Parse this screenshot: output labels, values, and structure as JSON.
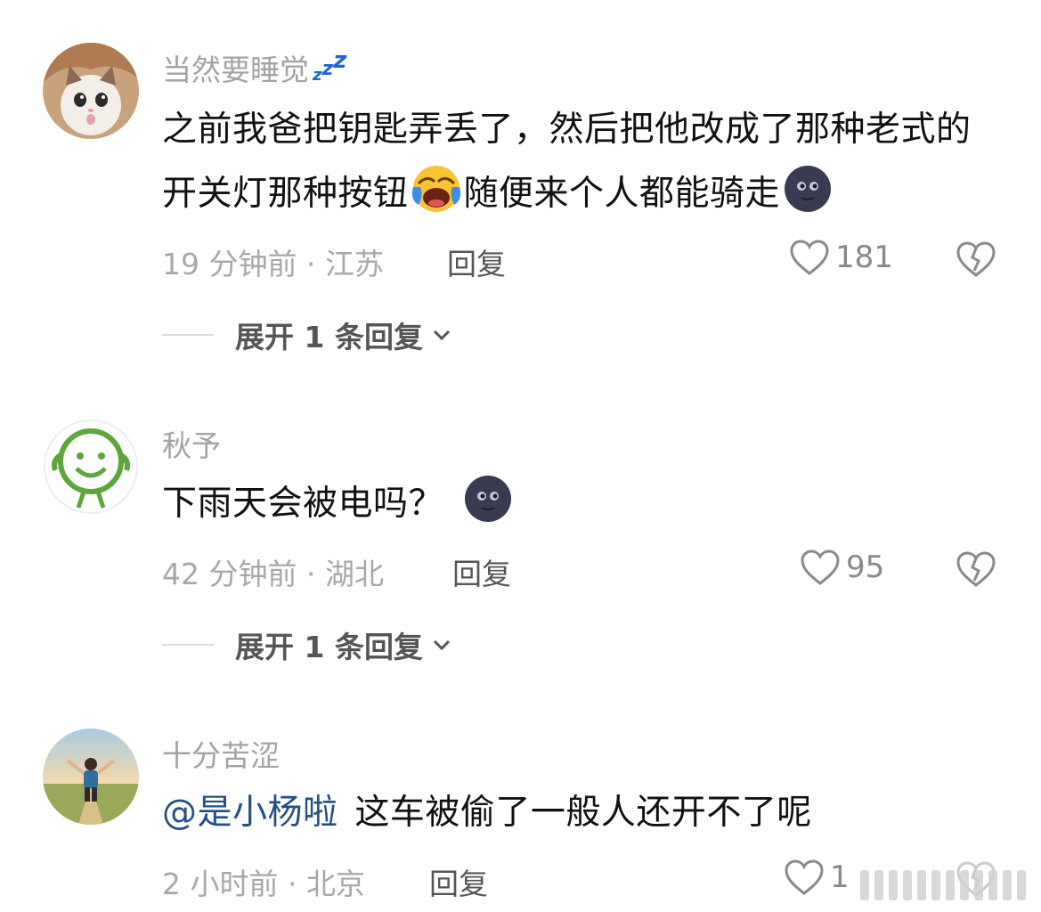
{
  "comments": [
    {
      "username": "当然要睡觉",
      "text_parts": [
        "之前我爸把钥匙弄丢了，然后把他改成了那种老式的开关灯那种按钮",
        "随便来个人都能骑走"
      ],
      "time": "19 分钟前",
      "location": "江苏",
      "reply_label": "回复",
      "likes": "181",
      "expand_label": "展开 1 条回复"
    },
    {
      "username": "秋予",
      "text": "下雨天会被电吗？",
      "time": "42 分钟前",
      "location": "湖北",
      "reply_label": "回复",
      "likes": "95",
      "expand_label": "展开 1 条回复"
    },
    {
      "username": "十分苦涩",
      "mention": "@是小杨啦",
      "text": "这车被偷了一般人还开不了呢",
      "time": "2 小时前",
      "location": "北京",
      "reply_label": "回复",
      "likes": "1"
    }
  ],
  "meta_separator": " · ",
  "colors": {
    "mention": "#244f86",
    "meta": "#a8a8a8",
    "username": "#a3a3a3",
    "zzz": "#1d63d8"
  },
  "icons": [
    "zzz-badge",
    "laughing-crying-emoji",
    "new-moon-face-emoji",
    "heart-outline-icon",
    "broken-heart-icon",
    "chevron-down-icon"
  ]
}
